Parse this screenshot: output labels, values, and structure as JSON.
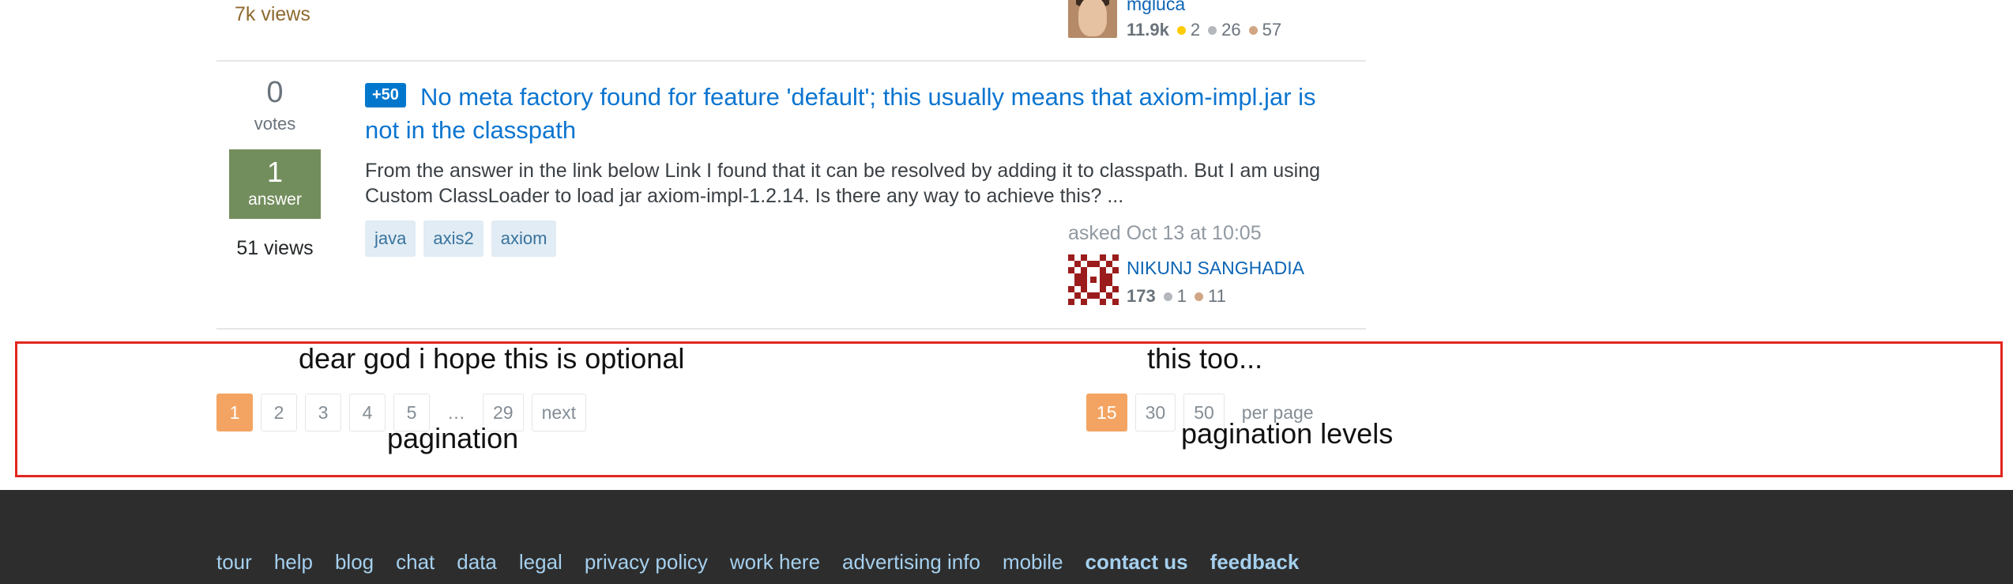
{
  "prev_question": {
    "views": "7k views",
    "user": {
      "name": "mgluca",
      "reputation": "11.9k",
      "gold": "2",
      "silver": "26",
      "bronze": "57"
    }
  },
  "question": {
    "votes": "0",
    "votes_label": "votes",
    "answers": "1",
    "answers_label": "answer",
    "views": "51 views",
    "bounty": "+50",
    "title": "No meta factory found for feature 'default'; this usually means that axiom-impl.jar is not in the classpath",
    "excerpt": "From the answer in the link below Link I found that it can be resolved by adding it to classpath. But I am using Custom ClassLoader to load jar axiom-impl-1.2.14. Is there any way to achieve this? ...",
    "tags": [
      "java",
      "axis2",
      "axiom"
    ],
    "asked": "asked Oct 13 at 10:05",
    "user": {
      "name": "NIKUNJ SANGHADIA",
      "reputation": "173",
      "silver": "1",
      "bronze": "11"
    }
  },
  "annotations": {
    "top_left": "dear god i hope this is optional",
    "top_right": "this too...",
    "pagination": "pagination",
    "pagination_levels": "pagination levels"
  },
  "pagination": {
    "pages": [
      "1",
      "2",
      "3",
      "4",
      "5",
      "…",
      "29",
      "next"
    ],
    "current": "1"
  },
  "page_size": {
    "options": [
      "15",
      "30",
      "50"
    ],
    "current": "15",
    "label": "per page"
  },
  "footer": {
    "links": [
      "tour",
      "help",
      "blog",
      "chat",
      "data",
      "legal",
      "privacy policy",
      "work here",
      "advertising info",
      "mobile"
    ],
    "bold_links": [
      "contact us",
      "feedback"
    ]
  },
  "colors": {
    "link_blue": "#0c75d0",
    "accent_orange": "#f4a462",
    "answered_green": "#738e5d",
    "annotation_red": "#e2261f",
    "footer_bg": "#2d2d2d"
  }
}
